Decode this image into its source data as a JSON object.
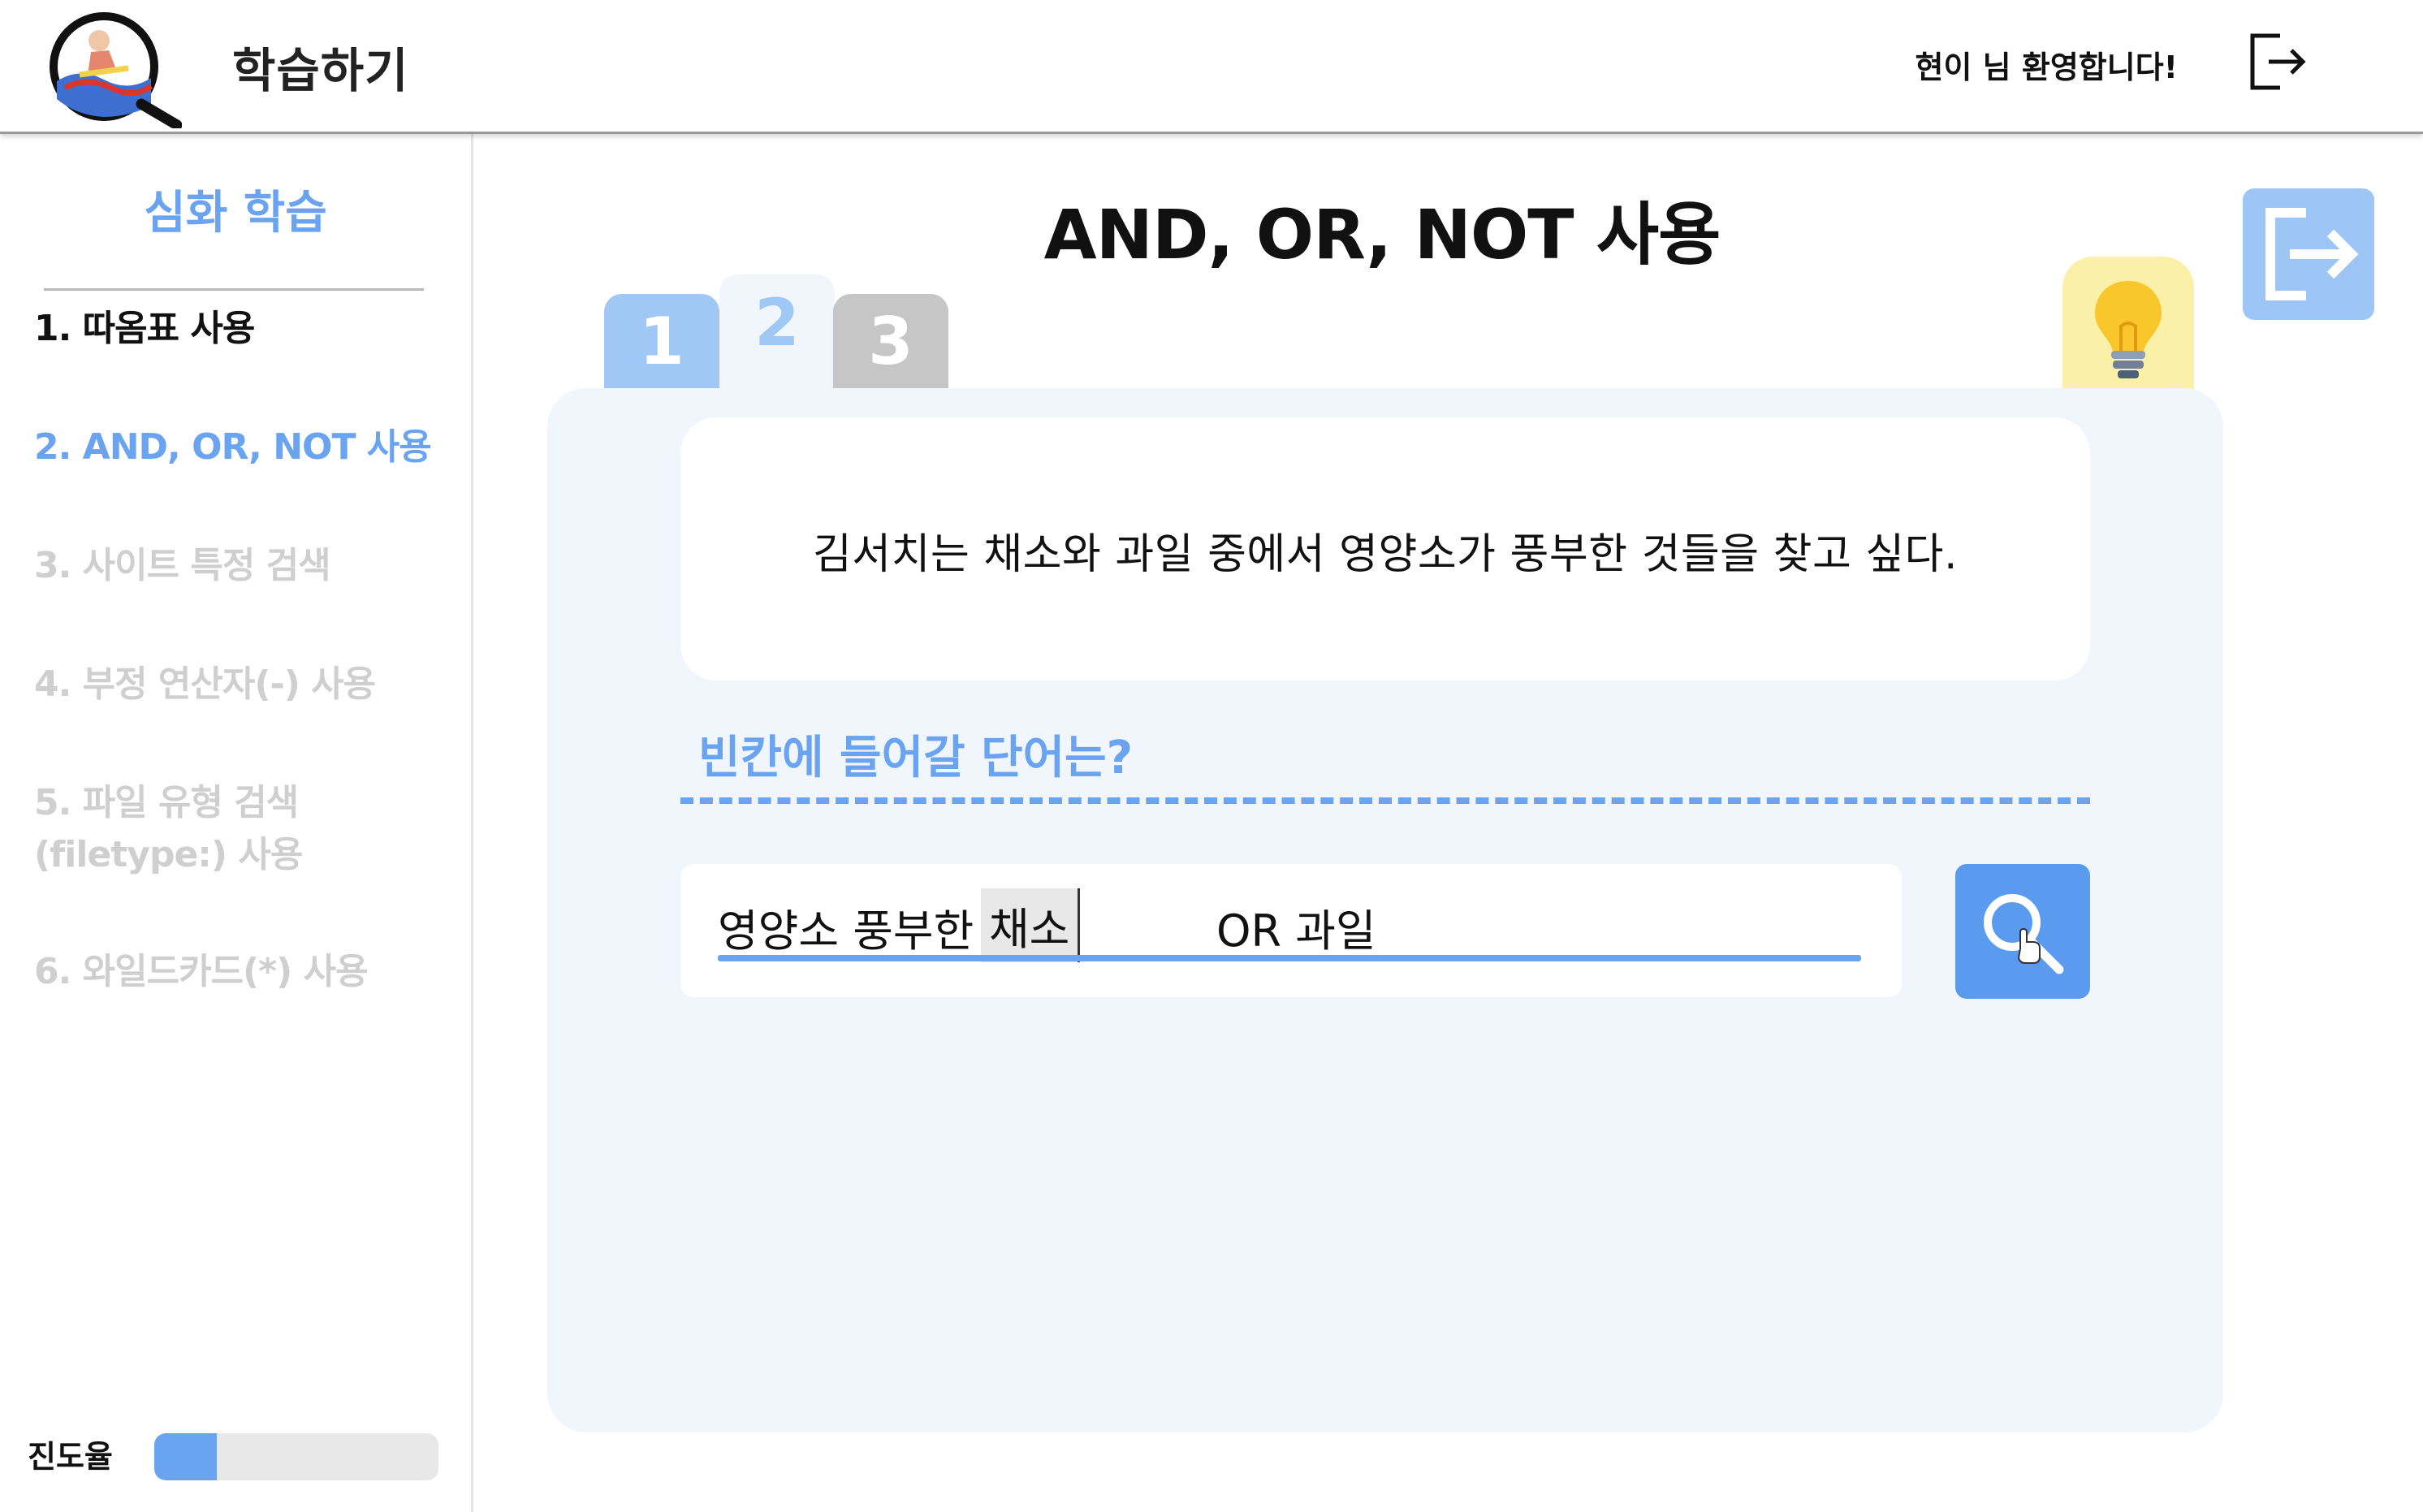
{
  "header": {
    "app_title": "학습하기",
    "welcome": "현이 님 환영합니다!",
    "logo_icon": "magnifier-surfer-logo",
    "logout_icon": "logout-icon"
  },
  "sidebar": {
    "title": "심화 학습",
    "items": [
      {
        "label": "1. 따옴표 사용",
        "state": "done"
      },
      {
        "label": "2. AND, OR, NOT 사용",
        "state": "active"
      },
      {
        "label": "3. 사이트 특정 검색",
        "state": "locked"
      },
      {
        "label": "4. 부정 연산자(-) 사용",
        "state": "locked"
      },
      {
        "label": "5. 파일 유형 검색\n(filetype:) 사용",
        "label_line1": "5. 파일 유형 검색",
        "label_line2": "(filetype:) 사용",
        "state": "locked"
      },
      {
        "label": "6. 와일드카드(*) 사용",
        "state": "locked"
      }
    ],
    "progress": {
      "label": "진도율",
      "fraction": 0.22
    }
  },
  "main": {
    "title": "AND, OR, NOT 사용",
    "tabs": [
      {
        "label": "1",
        "state": "completed"
      },
      {
        "label": "2",
        "state": "current"
      },
      {
        "label": "3",
        "state": "locked"
      }
    ],
    "question": "김서치는 채소와 과일 중에서 영양소가 풍부한 것들을 찾고 싶다.",
    "prompt": "빈칸에 들어갈 단어는?",
    "answer": {
      "before": "영양소 풍부한",
      "blank_value": "채소",
      "after": "OR 과일"
    },
    "hint_icon": "lightbulb-icon",
    "exit_icon": "exit-icon",
    "search_icon": "search-icon"
  },
  "colors": {
    "accent": "#6aa3f0",
    "panel": "#f1f6fd",
    "hint": "#fbf0a8",
    "tab_done": "#a0c8f6",
    "tab_locked": "#c6c6c6"
  }
}
